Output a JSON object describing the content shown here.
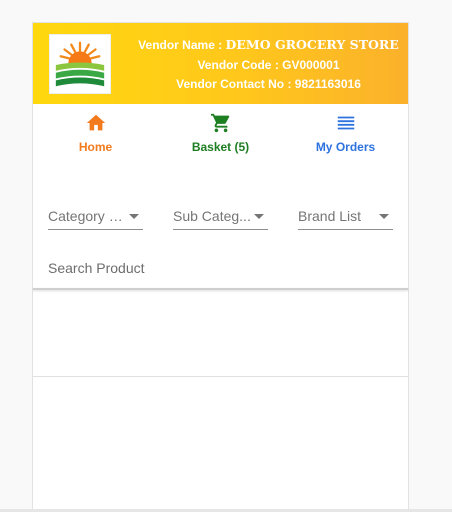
{
  "header": {
    "logo_icon": "farm-sun-logo-icon",
    "vendor_name": "Vendor Name : ",
    "vendor_name_value": "DEMO GROCERY STORE",
    "vendor_code": "Vendor Code : GV000001",
    "vendor_contact": "Vendor Contact No : 9821163016",
    "gradient_colors": [
      "#ffd80e",
      "#fbb12b"
    ]
  },
  "nav": {
    "home": {
      "label": "Home",
      "icon": "home-icon",
      "color": "#f27b1f"
    },
    "basket": {
      "label": "Basket (5)",
      "icon": "cart-icon",
      "color": "#1e7e22"
    },
    "orders": {
      "label": "My Orders",
      "icon": "list-icon",
      "color": "#2d73e0"
    }
  },
  "filters": {
    "category": "Category L...",
    "subcategory": "Sub Categ...",
    "brand": "Brand List"
  },
  "search": {
    "placeholder": "Search Product",
    "value": ""
  }
}
